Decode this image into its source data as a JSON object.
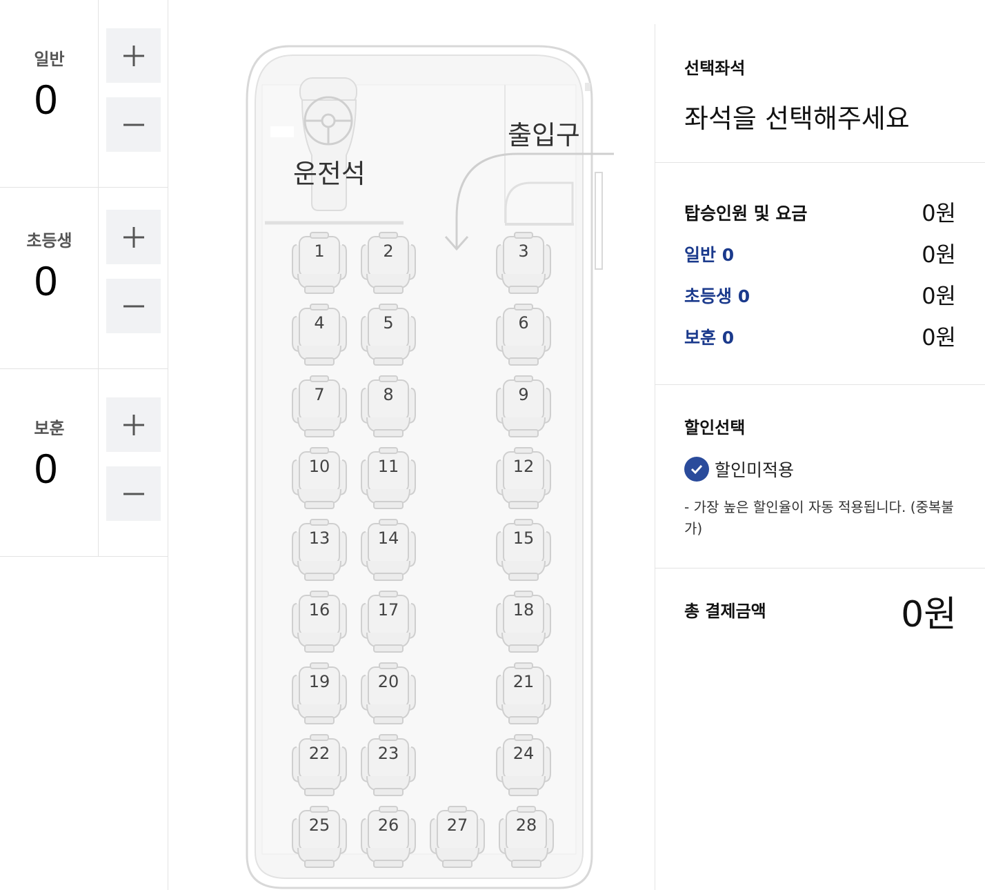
{
  "counters": [
    {
      "label": "일반",
      "value": "0"
    },
    {
      "label": "초등생",
      "value": "0"
    },
    {
      "label": "보훈",
      "value": "0"
    }
  ],
  "bus": {
    "driver_label": "운전석",
    "entrance_label": "출입구",
    "seats": [
      "1",
      "2",
      "3",
      "4",
      "5",
      "6",
      "7",
      "8",
      "9",
      "10",
      "11",
      "12",
      "13",
      "14",
      "15",
      "16",
      "17",
      "18",
      "19",
      "20",
      "21",
      "22",
      "23",
      "24",
      "25",
      "26",
      "27",
      "28"
    ]
  },
  "panel": {
    "seat_title": "선택좌석",
    "seat_prompt": "좌석을 선택해주세요",
    "fare": {
      "title": "탑승인원 및 요금",
      "total": "0원",
      "rows": [
        {
          "label": "일반 0",
          "value": "0원"
        },
        {
          "label": "초등생 0",
          "value": "0원"
        },
        {
          "label": "보훈 0",
          "value": "0원"
        }
      ]
    },
    "discount": {
      "title": "할인선택",
      "option": "할인미적용",
      "note": "- 가장 높은 할인율이 자동 적용됩니다. (중복불가)"
    },
    "total": {
      "title": "총 결제금액",
      "value": "0원"
    }
  },
  "colors": {
    "accent": "#1b3a8c",
    "check": "#2a4b9b",
    "button_bg": "#f1f2f4"
  }
}
